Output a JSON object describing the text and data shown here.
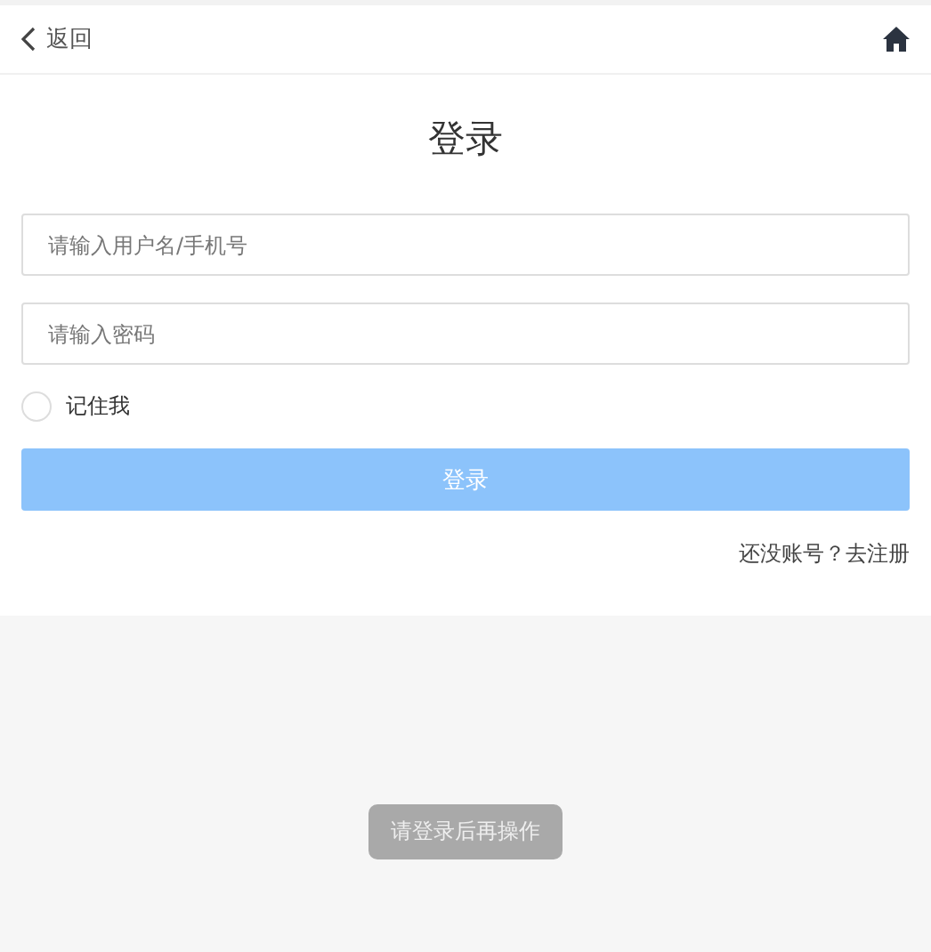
{
  "header": {
    "back_label": "返回"
  },
  "title": "登录",
  "fields": [
    {
      "placeholder": "请输入用户名/手机号"
    },
    {
      "placeholder": "请输入密码"
    }
  ],
  "remember": {
    "label": "记住我",
    "checked": false
  },
  "login_button": {
    "label": "登录",
    "disabled": true
  },
  "register_link": "还没账号？去注册",
  "toast": "请登录后再操作"
}
